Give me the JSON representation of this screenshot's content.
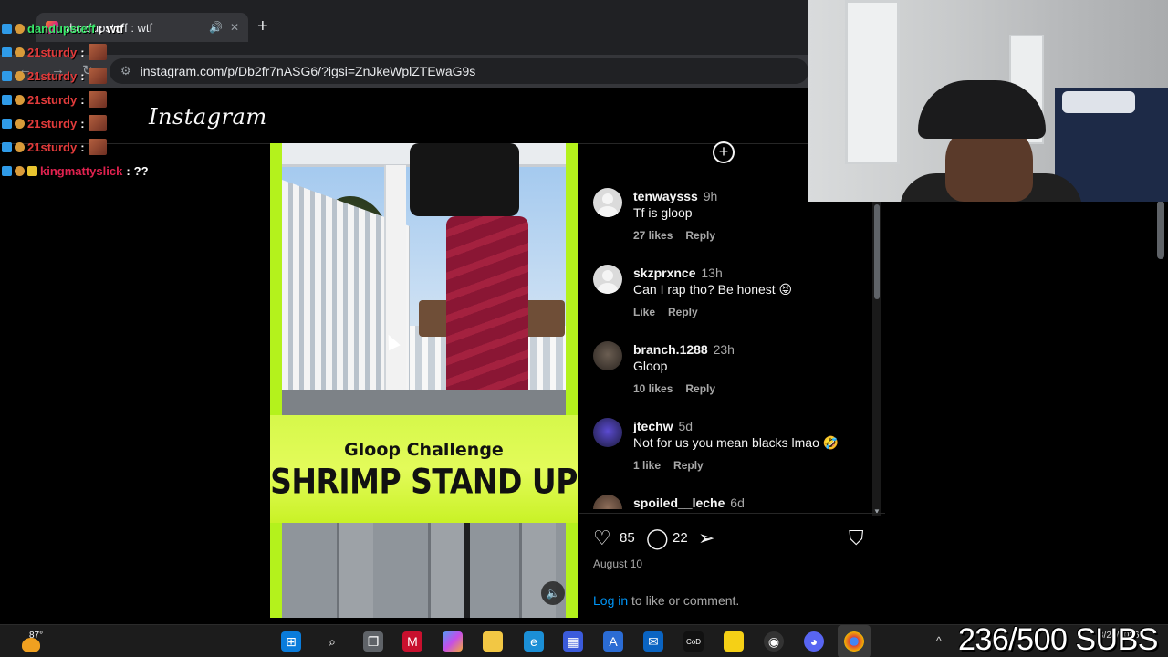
{
  "browser": {
    "tab_title": "dandupsteff : wtf",
    "url": "instagram.com/p/Db2fr7nASG6/?igsi=ZnJkeWplZTEwaG9s"
  },
  "instagram": {
    "logo": "Instagram",
    "caption_line1": "Gloop Challenge",
    "caption_line2": "SHRIMP STAND UP",
    "comments": [
      {
        "user": "tenwaysss",
        "time": "9h",
        "text": "Tf is gloop",
        "likes": "27 likes",
        "reply": "Reply"
      },
      {
        "user": "skzprxnce",
        "time": "13h",
        "text": "Can I rap tho? Be honest 😝",
        "likes": "Like",
        "reply": "Reply"
      },
      {
        "user": "branch.1288",
        "time": "23h",
        "text": "Gloop",
        "likes": "10 likes",
        "reply": "Reply"
      },
      {
        "user": "jtechw",
        "time": "5d",
        "text": "Not for us you mean blacks lmao 🤣",
        "likes": "1 like",
        "reply": "Reply"
      },
      {
        "user": "spoiled__leche",
        "time": "6d",
        "text": "",
        "likes": "",
        "reply": ""
      }
    ],
    "like_count": "85",
    "comment_count": "22",
    "post_date": "August 10",
    "login_link": "Log in",
    "login_rest": " to like or comment."
  },
  "chat": [
    {
      "user": "dandupsteff",
      "msg": "wtf",
      "color": "green",
      "emote": false
    },
    {
      "user": "21sturdy",
      "msg": "",
      "color": "red",
      "emote": true
    },
    {
      "user": "21sturdy",
      "msg": "",
      "color": "red",
      "emote": true
    },
    {
      "user": "21sturdy",
      "msg": "",
      "color": "red",
      "emote": true
    },
    {
      "user": "21sturdy",
      "msg": "",
      "color": "red",
      "emote": true
    },
    {
      "user": "21sturdy",
      "msg": "",
      "color": "red",
      "emote": true
    },
    {
      "user": "kingmattyslick",
      "msg": "??",
      "color": "pink",
      "emote": false
    }
  ],
  "taskbar": {
    "temperature": "87°",
    "clock_date": "8/24/2026"
  },
  "stream": {
    "subs": "236/500 SUBS"
  }
}
